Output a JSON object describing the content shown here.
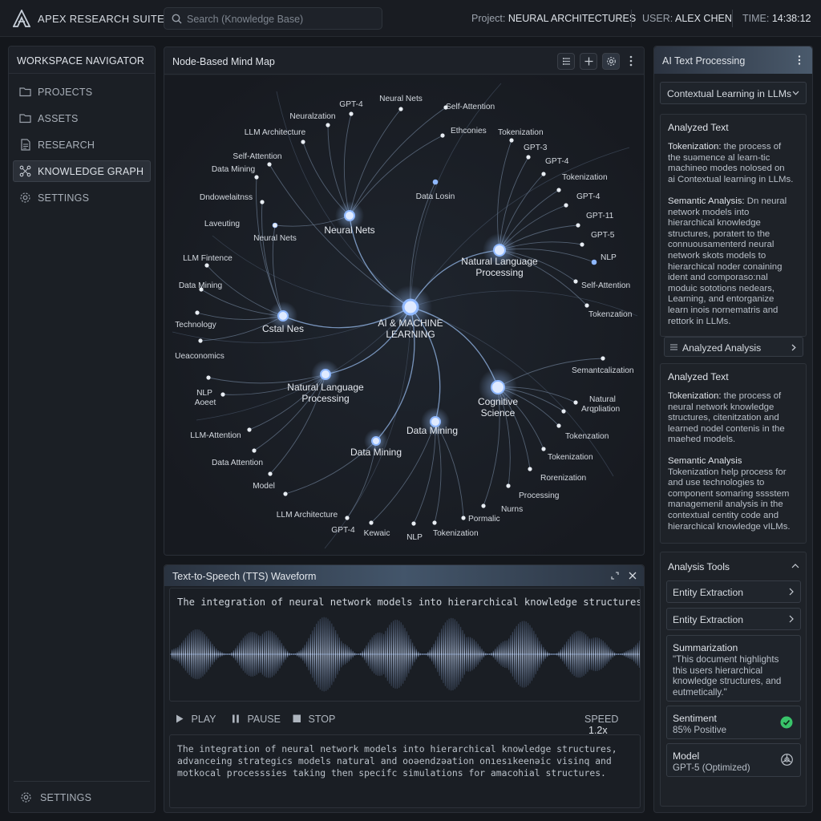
{
  "header": {
    "app_title": "APEX RESEARCH SUITE",
    "search_placeholder": "Search (Knowledge Base)",
    "project_label": "Project:",
    "project_value": "NEURAL ARCHITECTURES",
    "user_label": "USER:",
    "user_value": "ALEX CHEN",
    "time_label": "TIME:",
    "time_value": "14:38:12"
  },
  "sidebar": {
    "title": "WORKSPACE NAVIGATOR",
    "items": [
      {
        "label": "PROJECTS",
        "icon": "folder-icon"
      },
      {
        "label": "ASSETS",
        "icon": "folder-icon"
      },
      {
        "label": "RESEARCH",
        "icon": "document-icon"
      },
      {
        "label": "KNOWLEDGE GRAPH",
        "icon": "graph-icon",
        "active": true
      },
      {
        "label": "SETTINGS",
        "icon": "gear-icon"
      }
    ],
    "footer_label": "SETTINGS"
  },
  "mindmap": {
    "title": "Node-Based Mind Map",
    "accent": "#8fb8ff",
    "hubs": [
      {
        "id": "center",
        "label": [
          "AI & MACHINE",
          "LEARNING"
        ]
      },
      {
        "id": "nn",
        "label": [
          "Neural Nets"
        ]
      },
      {
        "id": "nlp1",
        "label": [
          "Natural Language",
          "Processing"
        ]
      },
      {
        "id": "cstal",
        "label": [
          "Cstal Nes"
        ]
      },
      {
        "id": "nlp2",
        "label": [
          "Natural Language",
          "Processing"
        ]
      },
      {
        "id": "cog",
        "label": [
          "Cognitive",
          "Science"
        ]
      },
      {
        "id": "dm1",
        "label": [
          "Data Mining"
        ]
      },
      {
        "id": "dm2",
        "label": [
          "Data Mining"
        ]
      }
    ],
    "leaves": [
      "Neural Nets",
      "Self-Attention",
      "GPT-4",
      "Neuralzation",
      "LLM Architecture",
      "Ethconies",
      "Self-Attention",
      "Data Mining",
      "Tokenization",
      "GPT-3",
      "Dndowelaitnss",
      "GPT-4",
      "Tokenization",
      "Data Losin",
      "GPT-4",
      "Laveuting",
      "GPT-11",
      "Neural Nets",
      "GPT-5",
      "NLP",
      "LLM Fintence",
      "Self-Attention",
      "Data Mining",
      "Tokenzation",
      "Technology",
      "Ueaconomics",
      "Semantcalization",
      "NLP",
      "Aoeet",
      "Natural",
      "Arqpliation",
      "LLM-Attention",
      "Tokenzation",
      "Tokenization",
      "Data Attention",
      "Rorenization",
      "Model",
      "Processing",
      "Nurns",
      "LLM Architecture",
      "Pormalic",
      "GPT-4",
      "Kewaic",
      "NLP",
      "Tokenization"
    ]
  },
  "tts": {
    "title": "Text-to-Speech (TTS) Waveform",
    "input_text": "The integration of neural network models into hierarchical knowledge structures...",
    "controls": {
      "play": "PLAY",
      "pause": "PAUSE",
      "stop": "STOP",
      "speed_label": "SPEED",
      "speed_value": "1.2x"
    },
    "output_lines": [
      "The integration of neural network models into hierarchical knowledge structures,",
      "advanceing strategics models natural and ooəendzəation onıesıkeenəic visinq and",
      "motkocal processsies taking then specifc simulations for amacohial structures."
    ]
  },
  "right_panel": {
    "title": "AI Text Processing",
    "dropdown_value": "Contextual Learning in LLMs",
    "card1": {
      "title": "Analyzed Text",
      "p1_label": "Tokenization:",
      "p1_lines": [
        " the process of",
        "the suəmence al learn-tic",
        "machineo modes nolosed on",
        "ai Contextual learning in LLMs."
      ],
      "p2_label": "Semantic Analysis:",
      "p2_lines": [
        " Dn neural",
        "network models into",
        "hierarchical knowledge",
        "structures, poratert to the",
        "connuousamenterd neural",
        "network skots models to",
        "hierarchical noder conaining",
        "ident and comporaso:nal",
        "moduic sototions nedears,",
        "Learning, and entorganize",
        "learn inois nornematris and",
        "rettork in LLMs."
      ]
    },
    "analysis_button": "Analyzed Analysis",
    "card2": {
      "title": "Analyzed Text",
      "p1_label": "Tokenization:",
      "p1_lines": [
        " the process of",
        "neural network knowledge",
        "structures, citenitzation and",
        "learned nodel contenis in the",
        "maehed models."
      ],
      "p2_label": "Semantic Analysis",
      "p2_lines": [
        "Tokenization help process for",
        "and use technologies to",
        "component somaring sssstem",
        "managemenil analysis in the",
        "contextual centity code and",
        "hierarchical knowledge vILMs."
      ]
    },
    "tools": {
      "title": "Analysis Tools",
      "entity1": "Entity Extraction",
      "entity2": "Entity Extraction",
      "summary_title": "Summarization",
      "summary_lines": [
        "\"This document highlights",
        "this users hierarchical",
        "knowledge structures, and",
        "eutmetically.\""
      ],
      "sentiment_title": "Sentiment",
      "sentiment_value": "85% Positive",
      "sentiment_color": "#39c46a",
      "model_title": "Model",
      "model_value": "GPT-5 (Optimized)"
    }
  }
}
